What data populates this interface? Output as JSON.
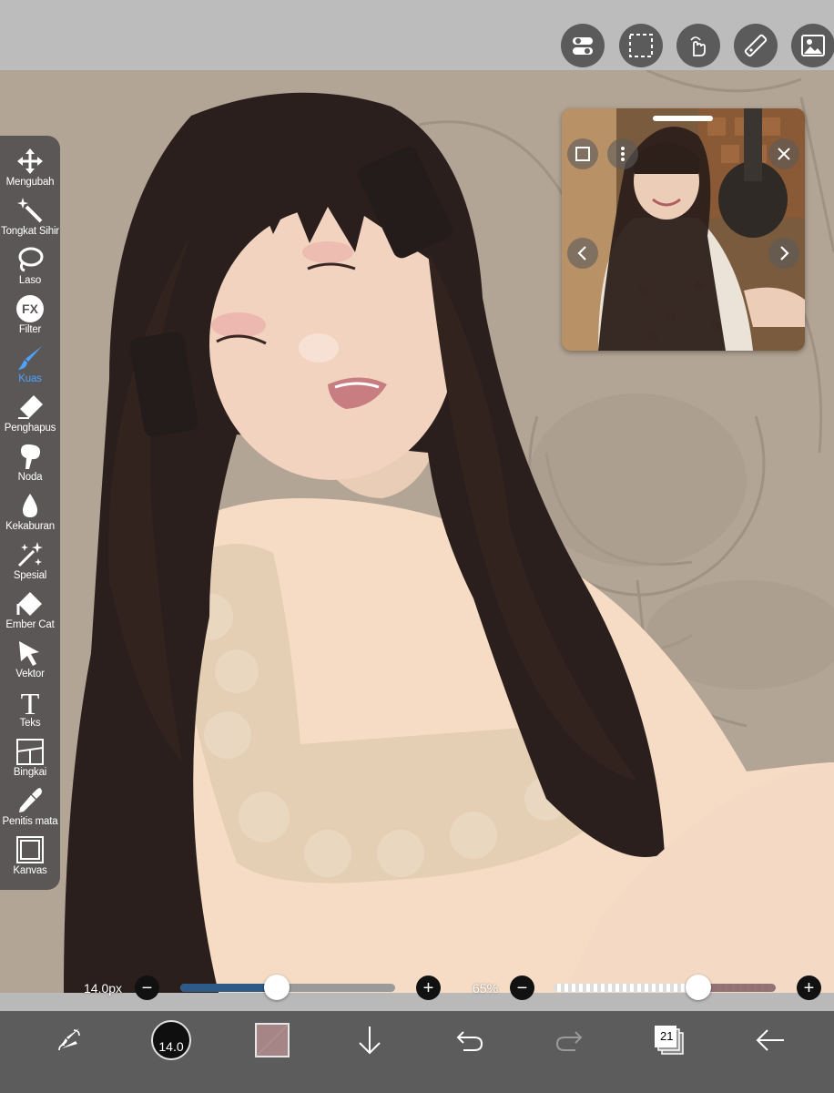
{
  "top_toolbar": {
    "icons": [
      "layer-toggle-icon",
      "selection-icon",
      "hand-touch-icon",
      "ruler-icon",
      "image-icon"
    ]
  },
  "left_toolbar": {
    "active_tool": "Kuas",
    "active_color": "#4da3ff",
    "tools": [
      {
        "label": "Mengubah",
        "icon": "move-arrows-icon"
      },
      {
        "label": "Tongkat Sihir",
        "icon": "magic-wand-icon"
      },
      {
        "label": "Laso",
        "icon": "lasso-icon"
      },
      {
        "label": "Filter",
        "icon": "fx-filter-icon"
      },
      {
        "label": "Kuas",
        "icon": "brush-icon"
      },
      {
        "label": "Penghapus",
        "icon": "eraser-icon"
      },
      {
        "label": "Noda",
        "icon": "smudge-icon"
      },
      {
        "label": "Kekaburan",
        "icon": "blur-drop-icon"
      },
      {
        "label": "Spesial",
        "icon": "sparkle-icon"
      },
      {
        "label": "Ember Cat",
        "icon": "paint-bucket-icon"
      },
      {
        "label": "Vektor",
        "icon": "vector-cursor-icon"
      },
      {
        "label": "Teks",
        "icon": "text-icon"
      },
      {
        "label": "Bingkai",
        "icon": "frame-icon"
      },
      {
        "label": "Penitis mata",
        "icon": "eyedropper-icon"
      },
      {
        "label": "Kanvas",
        "icon": "canvas-icon"
      }
    ]
  },
  "reference_window": {
    "icons": [
      "square-icon",
      "more-vertical-icon",
      "close-icon",
      "chevron-left-icon",
      "chevron-right-icon"
    ]
  },
  "brush_size": {
    "label": "14.0px",
    "level": 0.45,
    "fill_color": "#2d5a86"
  },
  "opacity": {
    "label": "65%",
    "level": 0.65,
    "fill_color": "#8a6566"
  },
  "bottom_toolbar": {
    "brush_size_display": "14.0",
    "layer_count": "21",
    "icons": [
      "brush-settings-icon",
      "brush-size-icon",
      "color-swatch-icon",
      "arrow-down-icon",
      "undo-icon",
      "redo-icon",
      "layers-icon",
      "back-arrow-icon"
    ],
    "swatch_color": "#a58585"
  }
}
